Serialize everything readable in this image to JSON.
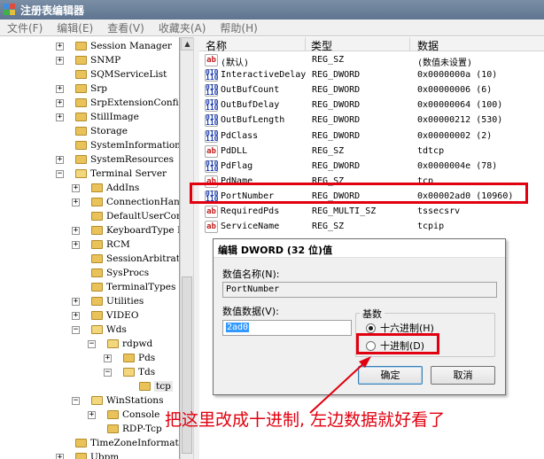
{
  "window": {
    "title": "注册表编辑器"
  },
  "menu": [
    "文件(F)",
    "编辑(E)",
    "查看(V)",
    "收藏夹(A)",
    "帮助(H)"
  ],
  "tree": [
    {
      "label": "Session Manager",
      "level": 0,
      "exp": "+"
    },
    {
      "label": "SNMP",
      "level": 0,
      "exp": "+"
    },
    {
      "label": "SQMServiceList",
      "level": 0,
      "exp": ""
    },
    {
      "label": "Srp",
      "level": 0,
      "exp": "+"
    },
    {
      "label": "SrpExtensionConfig",
      "level": 0,
      "exp": "+"
    },
    {
      "label": "StillImage",
      "level": 0,
      "exp": "+"
    },
    {
      "label": "Storage",
      "level": 0,
      "exp": ""
    },
    {
      "label": "SystemInformation",
      "level": 0,
      "exp": ""
    },
    {
      "label": "SystemResources",
      "level": 0,
      "exp": "+"
    },
    {
      "label": "Terminal Server",
      "level": 0,
      "exp": "-"
    },
    {
      "label": "AddIns",
      "level": 1,
      "exp": "+"
    },
    {
      "label": "ConnectionHandler",
      "level": 1,
      "exp": "+"
    },
    {
      "label": "DefaultUserConfiguration",
      "level": 1,
      "exp": ""
    },
    {
      "label": "KeyboardType Mapping",
      "level": 1,
      "exp": "+"
    },
    {
      "label": "RCM",
      "level": 1,
      "exp": "+"
    },
    {
      "label": "SessionArbitrationHelper",
      "level": 1,
      "exp": ""
    },
    {
      "label": "SysProcs",
      "level": 1,
      "exp": ""
    },
    {
      "label": "TerminalTypes",
      "level": 1,
      "exp": ""
    },
    {
      "label": "Utilities",
      "level": 1,
      "exp": "+"
    },
    {
      "label": "VIDEO",
      "level": 1,
      "exp": "+"
    },
    {
      "label": "Wds",
      "level": 1,
      "exp": "-"
    },
    {
      "label": "rdpwd",
      "level": 2,
      "exp": "-"
    },
    {
      "label": "Pds",
      "level": 3,
      "exp": "+"
    },
    {
      "label": "Tds",
      "level": 3,
      "exp": "-"
    },
    {
      "label": "tcp",
      "level": 4,
      "exp": "",
      "selected": true
    },
    {
      "label": "WinStations",
      "level": 1,
      "exp": "-"
    },
    {
      "label": "Console",
      "level": 2,
      "exp": "+"
    },
    {
      "label": "RDP-Tcp",
      "level": 2,
      "exp": ""
    },
    {
      "label": "TimeZoneInformation",
      "level": 0,
      "exp": ""
    },
    {
      "label": "Ubpm",
      "level": 0,
      "exp": "+"
    }
  ],
  "list": {
    "headers": {
      "name": "名称",
      "type": "类型",
      "data": "数据"
    },
    "rows": [
      {
        "icon": "sz",
        "name": "(默认)",
        "type": "REG_SZ",
        "data": "(数值未设置)"
      },
      {
        "icon": "dw",
        "name": "InteractiveDelay",
        "type": "REG_DWORD",
        "data": "0x0000000a (10)"
      },
      {
        "icon": "dw",
        "name": "OutBufCount",
        "type": "REG_DWORD",
        "data": "0x00000006 (6)"
      },
      {
        "icon": "dw",
        "name": "OutBufDelay",
        "type": "REG_DWORD",
        "data": "0x00000064 (100)"
      },
      {
        "icon": "dw",
        "name": "OutBufLength",
        "type": "REG_DWORD",
        "data": "0x00000212 (530)"
      },
      {
        "icon": "dw",
        "name": "PdClass",
        "type": "REG_DWORD",
        "data": "0x00000002 (2)"
      },
      {
        "icon": "sz",
        "name": "PdDLL",
        "type": "REG_SZ",
        "data": "tdtcp"
      },
      {
        "icon": "dw",
        "name": "PdFlag",
        "type": "REG_DWORD",
        "data": "0x0000004e (78)"
      },
      {
        "icon": "sz",
        "name": "PdName",
        "type": "REG_SZ",
        "data": "tcp"
      },
      {
        "icon": "dw",
        "name": "PortNumber",
        "type": "REG_DWORD",
        "data": "0x00002ad0 (10960)"
      },
      {
        "icon": "sz",
        "name": "RequiredPds",
        "type": "REG_MULTI_SZ",
        "data": "tssecsrv"
      },
      {
        "icon": "sz",
        "name": "ServiceName",
        "type": "REG_SZ",
        "data": "tcpip"
      }
    ]
  },
  "dialog": {
    "title": "编辑 DWORD (32 位)值",
    "name_label": "数值名称(N):",
    "name_value": "PortNumber",
    "data_label": "数值数据(V):",
    "data_value": "2ad0",
    "base_label": "基数",
    "hex_label": "十六进制(H)",
    "dec_label": "十进制(D)",
    "ok": "确定",
    "cancel": "取消"
  },
  "annotation": "把这里改成十进制, 左边数据就好看了",
  "colors": {
    "accent_red": "#e1000f",
    "selection": "#3399ff"
  }
}
